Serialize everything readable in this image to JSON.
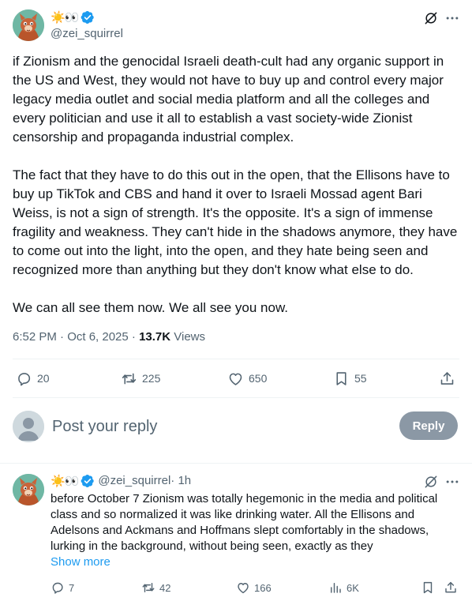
{
  "post": {
    "display_emoji": "☀️👀",
    "handle": "@zei_squirrel",
    "paragraphs": [
      "if Zionism and the genocidal Israeli death-cult had any organic support in the US and West, they would not have to buy up and control every major legacy media outlet and social media platform and all the colleges and every politician and use it all to establish a vast society-wide Zionist censorship and propaganda industrial complex.",
      "The fact that they have to do this out in the open, that the Ellisons have to buy up TikTok and CBS and hand it over to Israeli Mossad agent Bari Weiss, is not a sign of strength. It's the opposite. It's a sign of immense fragility and weakness. They can't hide in the shadows anymore, they have to come out into the light, into the open, and they hate being seen and recognized more than anything but they don't know what else to do.",
      "We can all see them now. We all see you now."
    ],
    "time": "6:52 PM · Oct 6, 2025 · ",
    "views_count": "13.7K",
    "views_label": " Views",
    "stats": {
      "replies": "20",
      "reposts": "225",
      "likes": "650",
      "bookmarks": "55"
    }
  },
  "reply_composer": {
    "placeholder": "Post your reply",
    "button_label": "Reply"
  },
  "reply": {
    "display_emoji": "☀️👀",
    "handle": "@zei_squirrel",
    "time_ago": " · 1h",
    "text": "before October 7 Zionism was totally hegemonic in the media and political class and so normalized it was like drinking water. All the Ellisons and Adelsons and Ackmans and Hoffmans slept comfortably in the shadows, lurking in the background, without being seen, exactly as they",
    "show_more": "Show more",
    "stats": {
      "replies": "7",
      "reposts": "42",
      "likes": "166",
      "views": "6K"
    }
  },
  "colors": {
    "accent": "#1d9bf0",
    "muted": "#536471",
    "text": "#0f1419",
    "reply_button": "#8b98a5",
    "verified": "#1d9bf0"
  }
}
